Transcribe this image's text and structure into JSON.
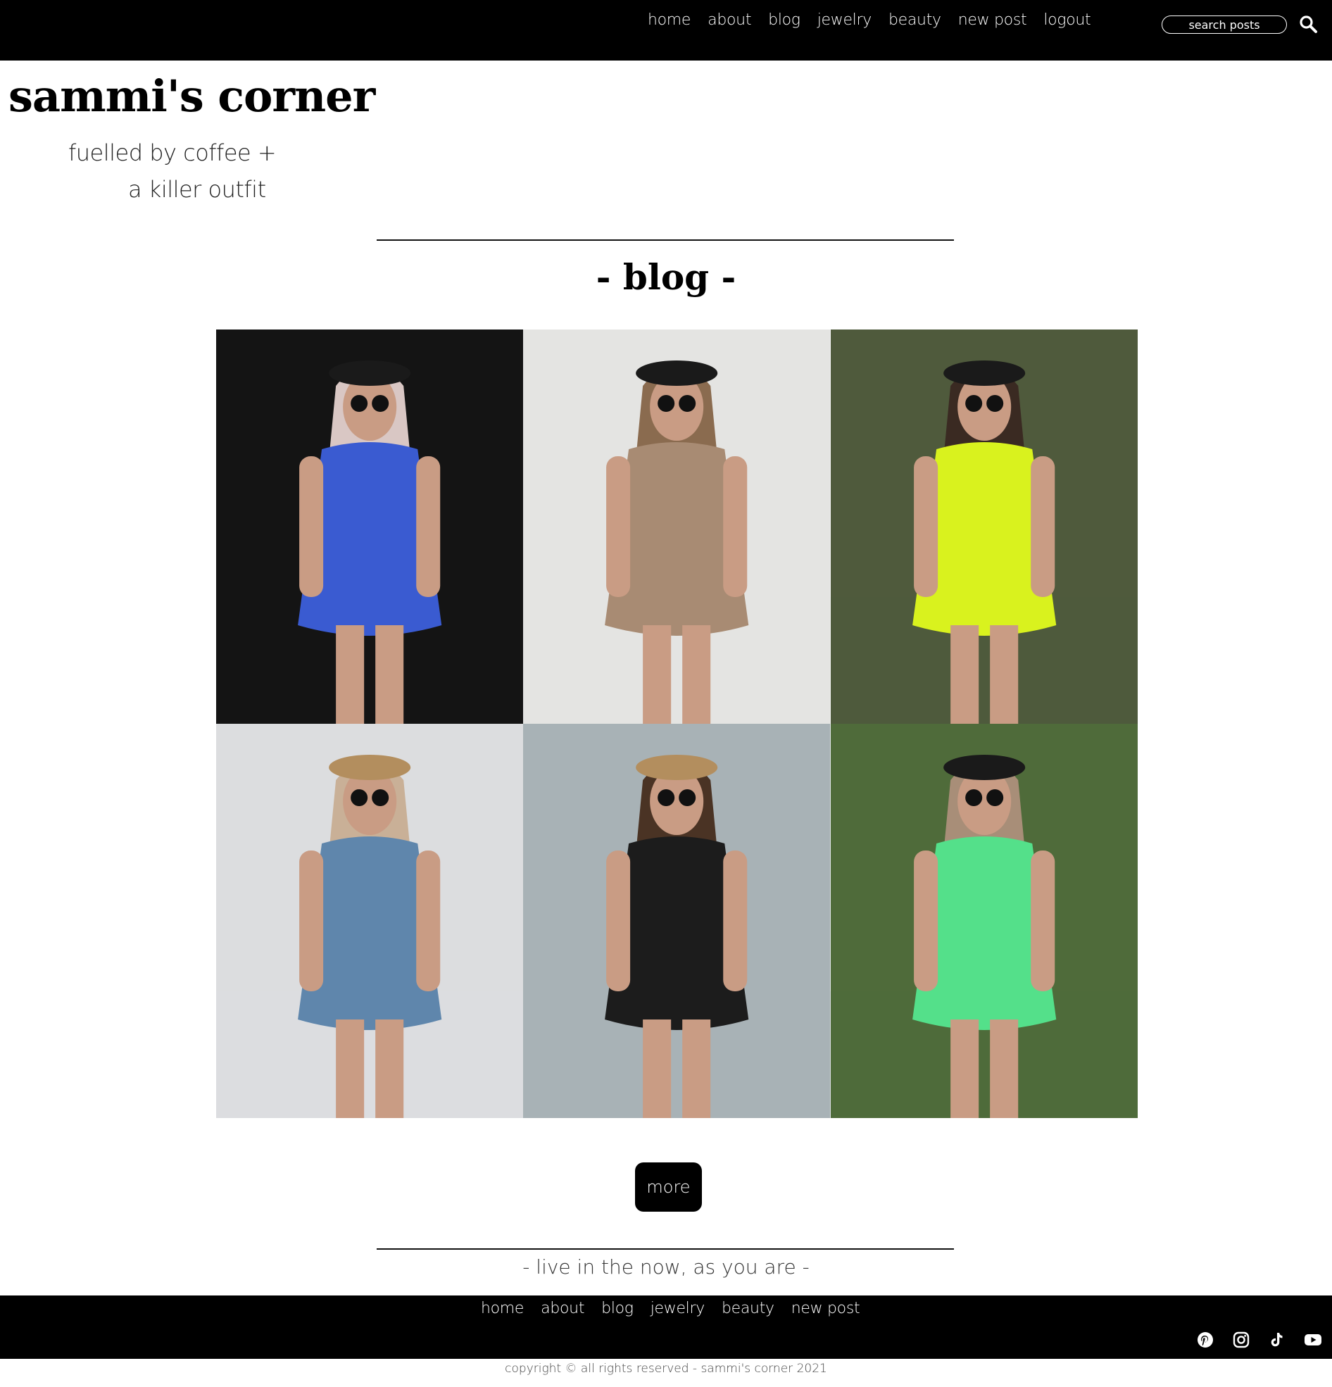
{
  "nav": {
    "items": [
      "home",
      "about",
      "blog",
      "jewelry",
      "beauty",
      "new post",
      "logout"
    ]
  },
  "search": {
    "placeholder": "search posts"
  },
  "site": {
    "title": "sammi's corner",
    "tagline_line1": "fuelled by coffee +",
    "tagline_line2": "a killer outfit"
  },
  "section": {
    "title": "- blog -"
  },
  "posts": [
    {
      "name": "post-denim-jacket",
      "bg": "#141414",
      "accent": "#3a5bd1",
      "hair": "#d9c7c4",
      "skin": "#c99c84"
    },
    {
      "name": "post-beret-beige-pants",
      "bg": "#e4e4e2",
      "accent": "#a88b73",
      "hair": "#8a6b4f",
      "skin": "#c99c84"
    },
    {
      "name": "post-neon-yellow-dress",
      "bg": "#4f5a3c",
      "accent": "#d9f21e",
      "hair": "#3a2a22",
      "skin": "#c99c84"
    },
    {
      "name": "post-denim-dress-straw-hat",
      "bg": "#dcdddf",
      "accent": "#5f86ac",
      "hair": "#c9b097",
      "skin": "#c99c84"
    },
    {
      "name": "post-black-dress-river",
      "bg": "#a8b2b6",
      "accent": "#1c1c1c",
      "hair": "#4a3324",
      "skin": "#c99c84"
    },
    {
      "name": "post-green-dress-garden",
      "bg": "#4f6b3a",
      "accent": "#54e08a",
      "hair": "#a88e78",
      "skin": "#c99c84"
    }
  ],
  "more_button": {
    "label": "more"
  },
  "footer": {
    "quote": "- live in the now, as you are -",
    "nav": [
      "home",
      "about",
      "blog",
      "jewelry",
      "beauty",
      "new post"
    ],
    "social": [
      "pinterest-icon",
      "instagram-icon",
      "tiktok-icon",
      "youtube-icon"
    ],
    "copyright": "copyright © all rights reserved - sammi's corner 2021"
  }
}
